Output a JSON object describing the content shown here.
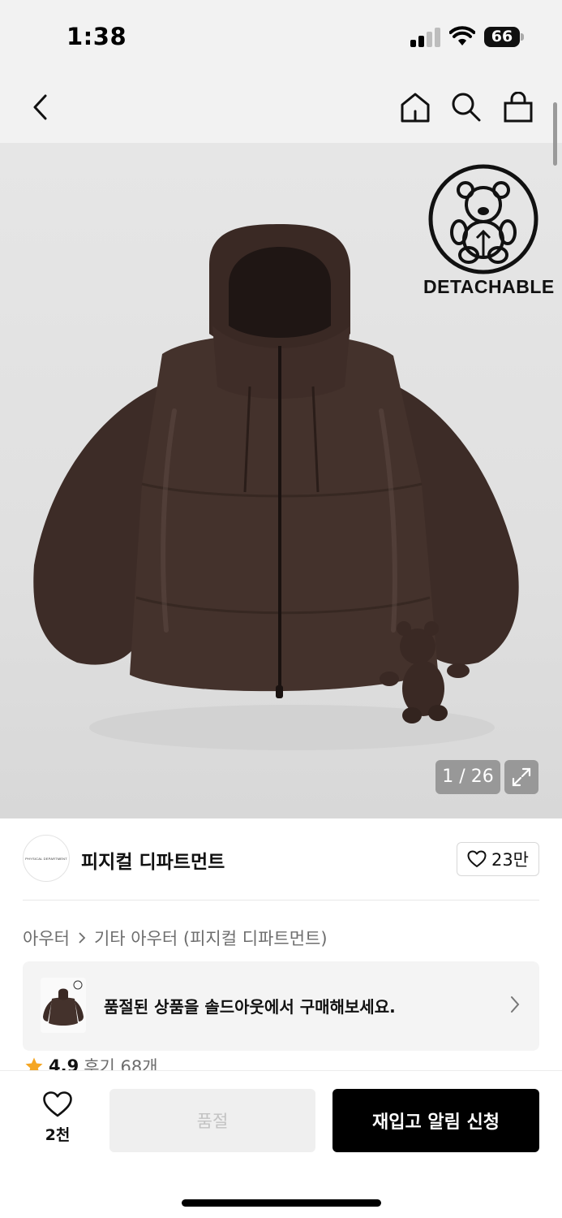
{
  "status_bar": {
    "time": "1:38",
    "battery": "66",
    "icons": [
      "signal-icon",
      "wifi-icon",
      "battery-icon"
    ]
  },
  "nav": {
    "icons": [
      "back-chevron-icon",
      "home-icon",
      "search-icon",
      "shopping-bag-icon"
    ]
  },
  "gallery": {
    "badge_label": "DETACHABLE",
    "counter": "1 / 26"
  },
  "brand": {
    "logo_text": "PHYSICAL DEPARTMENT",
    "name": "피지컬 디파트먼트",
    "likes": "23만"
  },
  "breadcrumb": {
    "level1": "아우터",
    "level2": "기타 아우터 (피지컬 디파트먼트)"
  },
  "soldout_banner": {
    "text": "품절된 상품을 솔드아웃에서 구매해보세요."
  },
  "rating": {
    "score": "4.9",
    "reviews": "후기 68개"
  },
  "bottom_bar": {
    "wish_count": "2천",
    "soldout_label": "품절",
    "restock_label": "재입고 알림 신청"
  },
  "colors": {
    "jacket": "#3a2a25",
    "primary_button": "#000000",
    "disabled_button": "#efefef",
    "star": "#f5a623"
  }
}
